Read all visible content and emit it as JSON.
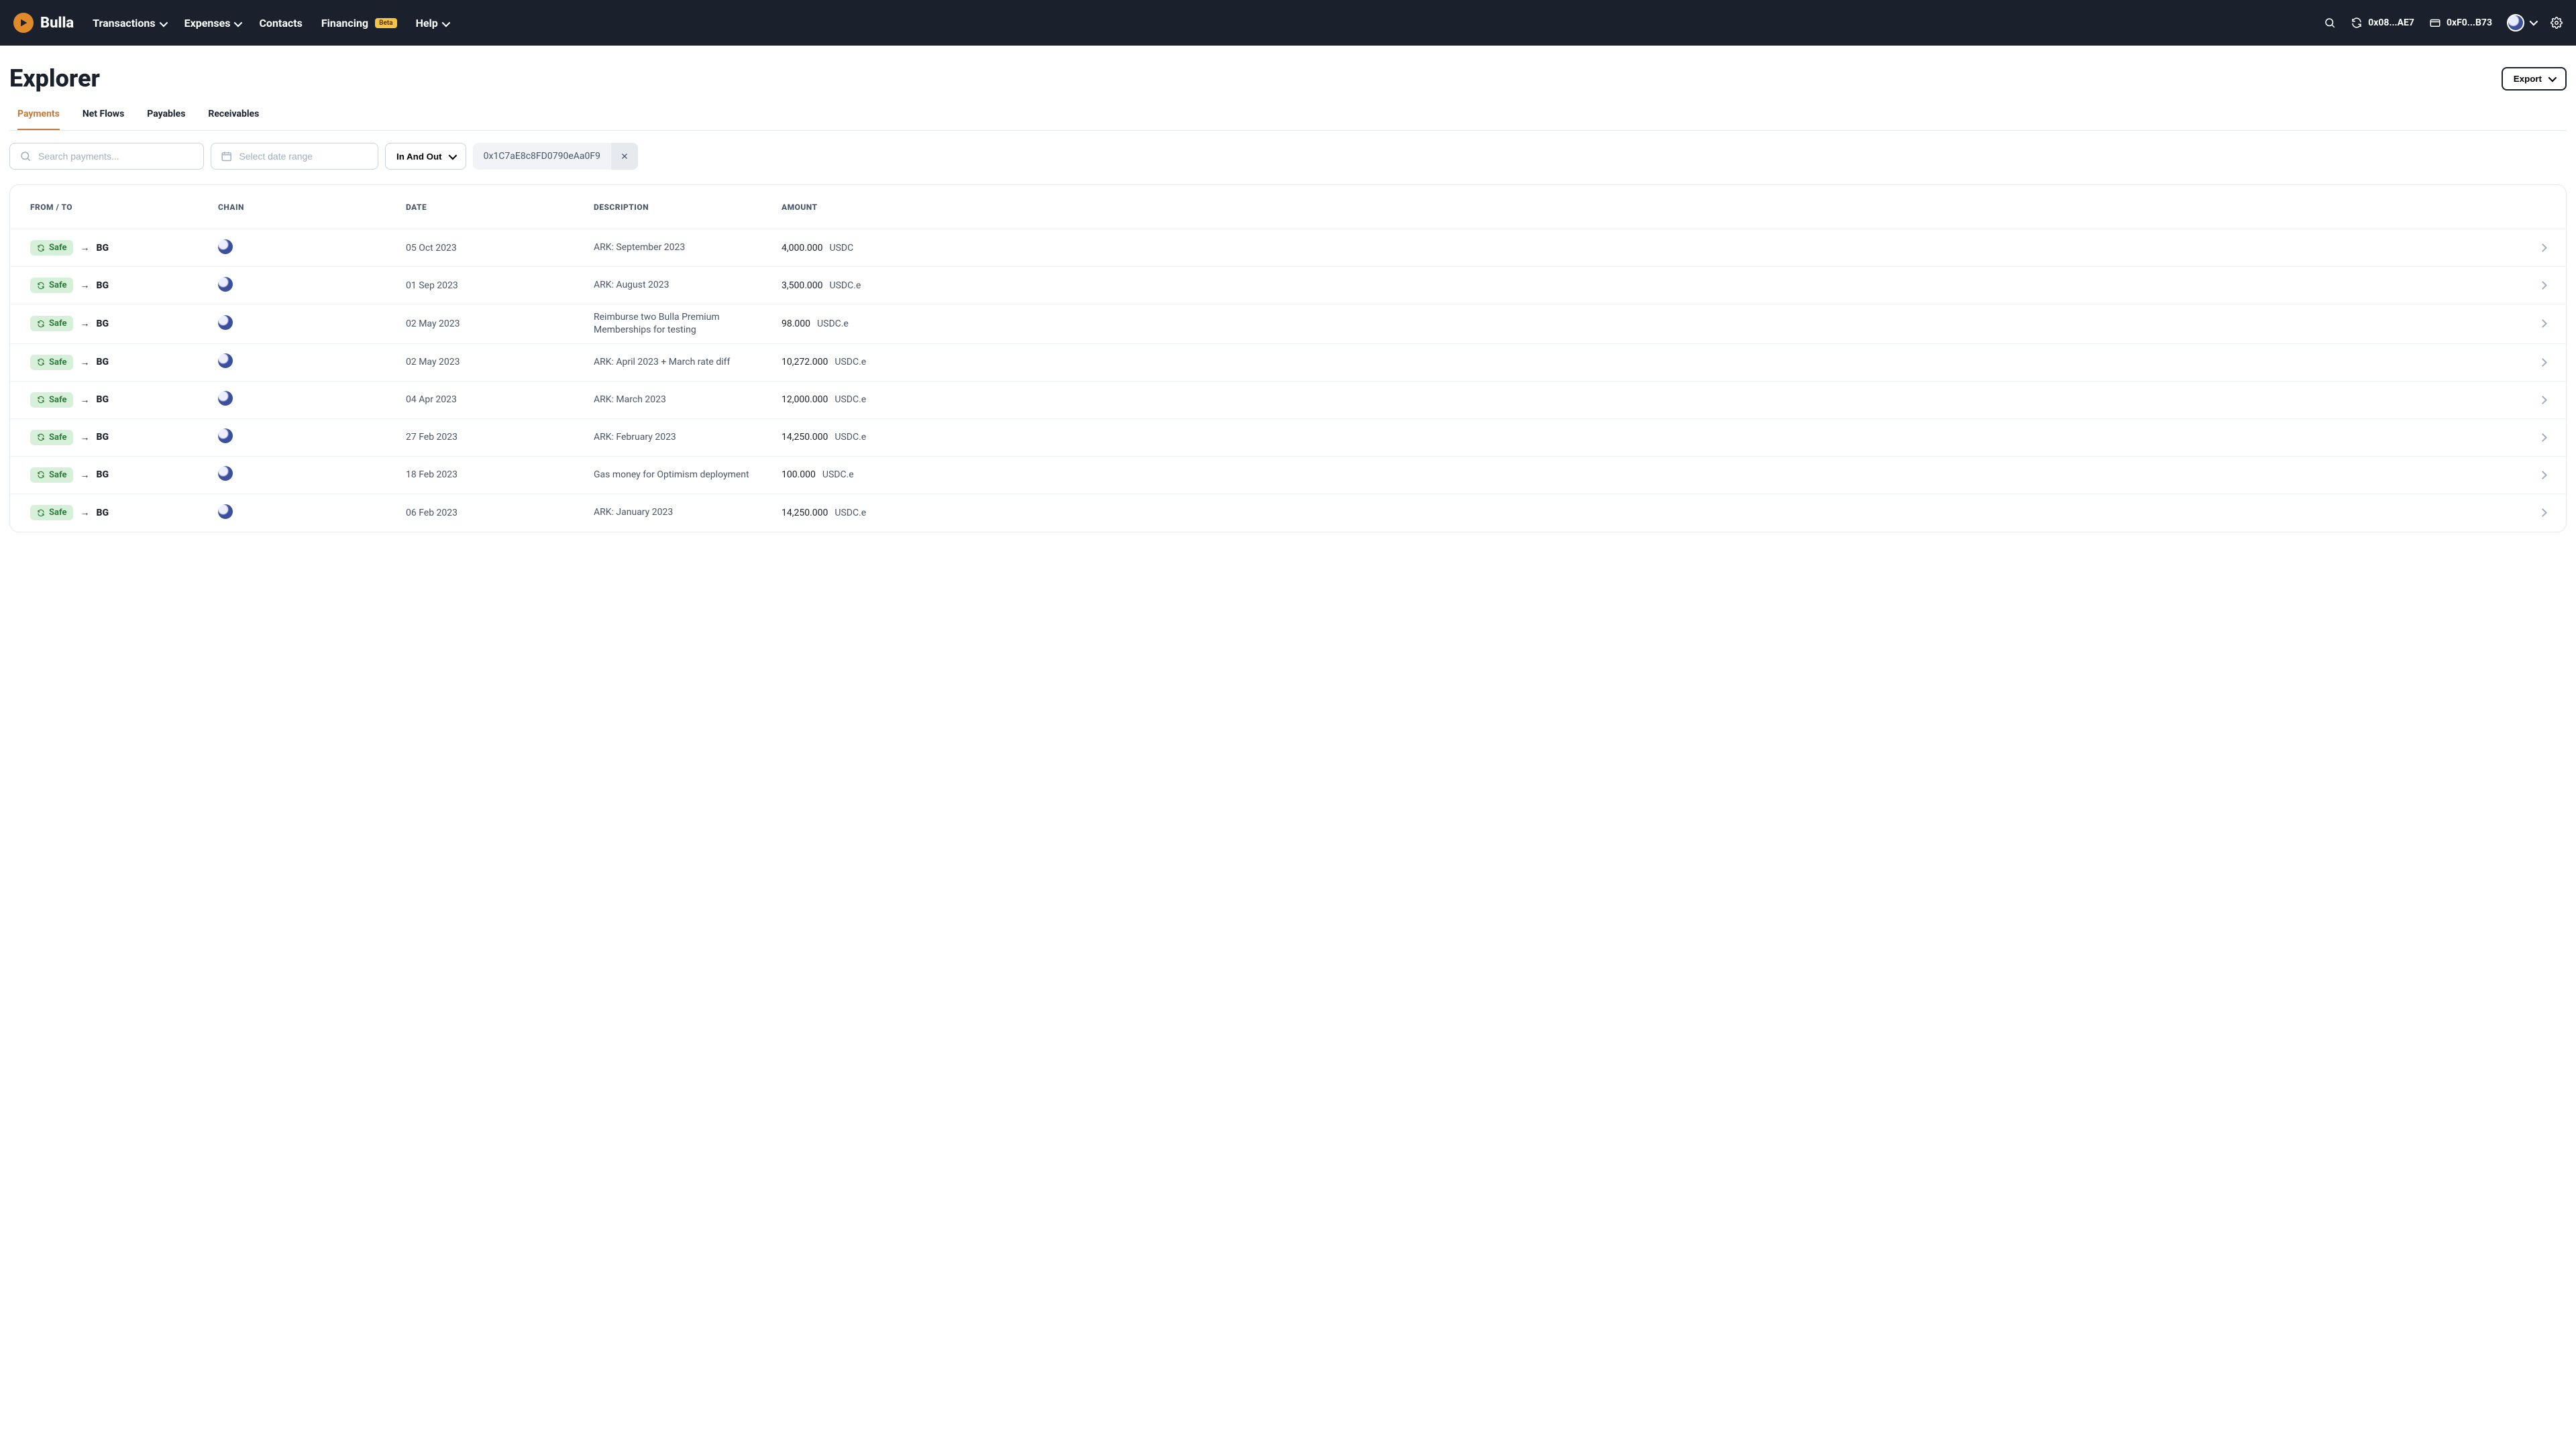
{
  "nav": {
    "brand": "Bulla",
    "links": [
      {
        "label": "Transactions",
        "has_dropdown": true
      },
      {
        "label": "Expenses",
        "has_dropdown": true
      },
      {
        "label": "Contacts",
        "has_dropdown": false
      },
      {
        "label": "Financing",
        "has_dropdown": false,
        "badge": "Beta"
      },
      {
        "label": "Help",
        "has_dropdown": true
      }
    ],
    "account_address": "0x08...AE7",
    "wallet_address": "0xF0...B73"
  },
  "page": {
    "title": "Explorer",
    "export_label": "Export"
  },
  "tabs": [
    {
      "label": "Payments",
      "active": true
    },
    {
      "label": "Net Flows",
      "active": false
    },
    {
      "label": "Payables",
      "active": false
    },
    {
      "label": "Receivables",
      "active": false
    }
  ],
  "filters": {
    "search_placeholder": "Search payments...",
    "date_placeholder": "Select date range",
    "direction_label": "In And Out",
    "filter_address": "0x1C7aE8c8FD0790eAa0F9"
  },
  "table": {
    "headers": {
      "from_to": "FROM / TO",
      "chain": "CHAIN",
      "date": "DATE",
      "description": "DESCRIPTION",
      "amount": "AMOUNT"
    },
    "from_badge_label": "Safe",
    "rows": [
      {
        "to": "BG",
        "date": "05 Oct 2023",
        "description": "ARK: September 2023",
        "amount": "4,000.000",
        "token": "USDC"
      },
      {
        "to": "BG",
        "date": "01 Sep 2023",
        "description": "ARK: August 2023",
        "amount": "3,500.000",
        "token": "USDC.e"
      },
      {
        "to": "BG",
        "date": "02 May 2023",
        "description": "Reimburse two Bulla Premium Memberships for testing",
        "amount": "98.000",
        "token": "USDC.e"
      },
      {
        "to": "BG",
        "date": "02 May 2023",
        "description": "ARK: April 2023 + March rate diff",
        "amount": "10,272.000",
        "token": "USDC.e"
      },
      {
        "to": "BG",
        "date": "04 Apr 2023",
        "description": "ARK: March 2023",
        "amount": "12,000.000",
        "token": "USDC.e"
      },
      {
        "to": "BG",
        "date": "27 Feb 2023",
        "description": "ARK: February 2023",
        "amount": "14,250.000",
        "token": "USDC.e"
      },
      {
        "to": "BG",
        "date": "18 Feb 2023",
        "description": "Gas money for Optimism deployment",
        "amount": "100.000",
        "token": "USDC.e"
      },
      {
        "to": "BG",
        "date": "06 Feb 2023",
        "description": "ARK: January 2023",
        "amount": "14,250.000",
        "token": "USDC.e"
      }
    ]
  }
}
